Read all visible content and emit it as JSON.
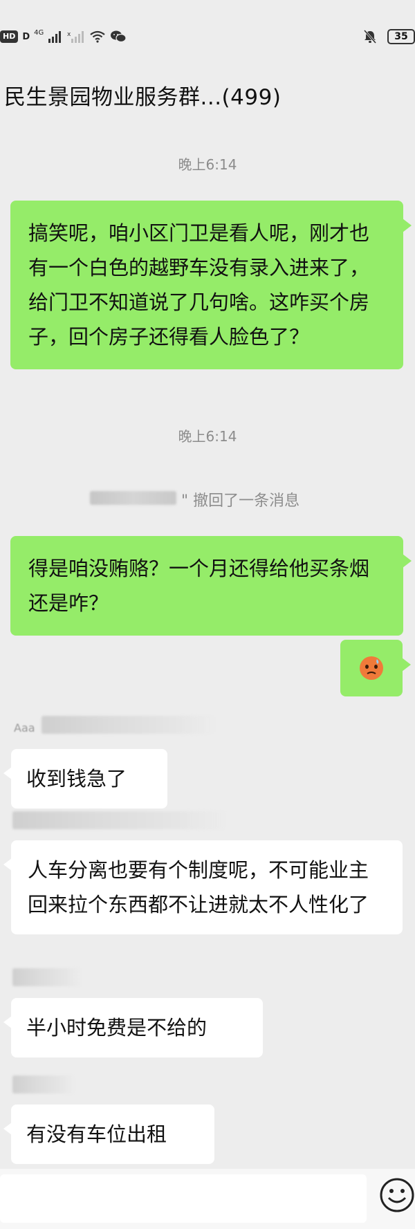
{
  "status_bar": {
    "hd_badge": "HD",
    "sim_label": "D",
    "network_label": "4G",
    "battery": "35"
  },
  "header": {
    "title": "民生景园物业服务群...(499)"
  },
  "messages": {
    "time_1": "晚上6:14",
    "out_1": "搞笑呢，咱小区门卫是看人呢，刚才也有一个白色的越野车没有录入进来了，给门卫不知道说了几句啥。这咋买个房子，回个房子还得看人脸色了？",
    "time_2": "晚上6:14",
    "recall_notice": "\" 撤回了一条消息",
    "out_2": "得是咱没贿赂？一个月还得给他买条烟还是咋？",
    "sender_1": "Aaa",
    "in_1": "收到钱急了",
    "in_2": "人车分离也要有个制度呢，不可能业主回来拉个东西都不让进就太不人性化了",
    "in_3": "半小时免费是不给的",
    "in_4": "有没有车位出租"
  },
  "icons": {
    "signal": "signal-icon",
    "wifi": "wifi-icon",
    "wechat": "wechat-icon",
    "mute": "mute-icon",
    "emoji": "emoji-icon"
  },
  "colors": {
    "background": "#ededed",
    "outgoing_bubble": "#95ec69",
    "incoming_bubble": "#ffffff",
    "time_text": "#8c8c8c"
  }
}
